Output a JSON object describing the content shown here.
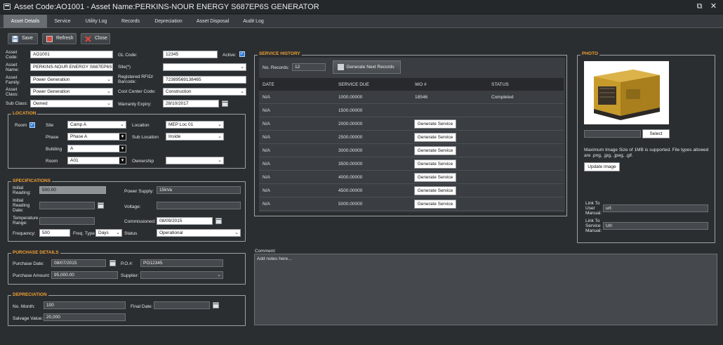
{
  "window": {
    "title": "Asset Code:AO1001 - Asset Name:PERKINS-NOUR ENERGY S687EP6S GENERATOR"
  },
  "tabs": [
    {
      "label": "Asset Details",
      "active": true
    },
    {
      "label": "Service"
    },
    {
      "label": "Utility Log"
    },
    {
      "label": "Records"
    },
    {
      "label": "Depreciation"
    },
    {
      "label": "Asset Disposal"
    },
    {
      "label": "Audit Log"
    }
  ],
  "toolbar": {
    "save": "Save",
    "refresh": "Refresh",
    "close": "Close"
  },
  "asset": {
    "code_label": "Asset Code:",
    "code": "AO1001",
    "name_label": "Asset Name:",
    "name": "PERKINS-NOUR ENERGY S687EP6S G",
    "family_label": "Asset Family:",
    "family": "Power Generation",
    "class_label": "Asset Class:",
    "class": "Power Generation",
    "subclass_label": "Sub Class:",
    "subclass": "Owned",
    "gl_label": "GL Code:",
    "gl": "12345",
    "active_label": "Active:",
    "site_label": "Site(*)",
    "site": "",
    "rfid_label": "Registered RFID/ Barcode:",
    "rfid": "72389569138465",
    "costcenter_label": "Cost Center Code:",
    "costcenter": "Construction",
    "warranty_label": "Warranty Expiry:",
    "warranty": "28/10/2017"
  },
  "location": {
    "legend": "LOCATION",
    "room_label": "Room",
    "site_label": "Site",
    "site": "Camp A",
    "phase_label": "Phase",
    "phase": "Phase A",
    "building_label": "Building",
    "building": "A",
    "room2_label": "Room",
    "room": "A01",
    "location_label": "Location",
    "location": "MEP Loc 01",
    "sublocation_label": "Sub Location",
    "sublocation": "Inside",
    "ownership_label": "Ownership",
    "ownership": ""
  },
  "specs": {
    "legend": "SPECIFICATIONS",
    "initial_reading_label": "Initial Reading:",
    "initial_reading": "500.00",
    "initial_reading_date_label": "Initial Reading Date:",
    "temp_label": "Temperature Range:",
    "frequency_label": "Frequency:",
    "frequency": "500",
    "freq_type_label": "Freq. Type",
    "freq_type": "Days",
    "power_label": "Power Supply:",
    "power": "15kVa",
    "voltage_label": "Voltage:",
    "commissioned_label": "Commissioned:",
    "commissioned": "08/09/2015",
    "status_label": "Status",
    "status": "Operational"
  },
  "purchase": {
    "legend": "PURCHASE DETAILS",
    "date_label": "Purchase Date:",
    "date": "08/07/2015",
    "amount_label": "Purchase Amount:",
    "amount": "95,000.00",
    "po_label": "P.O.#:",
    "po": "PO12345",
    "supplier_label": "Supplier:",
    "supplier": ""
  },
  "depreciation": {
    "legend": "DEPRECIATION",
    "months_label": "No. Month:",
    "months": "100",
    "salvage_label": "Salvage Value:",
    "salvage": "20,000",
    "final_label": "Final Date:"
  },
  "service_history": {
    "legend": "SERVICE HISTORY",
    "records_label": "No. Records:",
    "records": "12",
    "generate_label": "Generate Next Records",
    "columns": [
      "DATE",
      "SERVICE DUE",
      "WO #",
      "STATUS"
    ],
    "rows": [
      {
        "date": "N/A",
        "due": "1000.00000",
        "wo": "18546",
        "status": "Completed"
      },
      {
        "date": "N/A",
        "due": "1500.00000",
        "wo": "",
        "status": ""
      },
      {
        "date": "N/A",
        "due": "2000.00000",
        "wo": "Generate Service",
        "status": ""
      },
      {
        "date": "N/A",
        "due": "2500.00000",
        "wo": "Generate Service",
        "status": ""
      },
      {
        "date": "N/A",
        "due": "3000.00000",
        "wo": "Generate Service",
        "status": ""
      },
      {
        "date": "N/A",
        "due": "3500.00000",
        "wo": "Generate Service",
        "status": ""
      },
      {
        "date": "N/A",
        "due": "4000.00000",
        "wo": "Generate Service",
        "status": ""
      },
      {
        "date": "N/A",
        "due": "4500.00000",
        "wo": "Generate Service",
        "status": ""
      },
      {
        "date": "N/A",
        "due": "5000.00000",
        "wo": "Generate Service",
        "status": ""
      }
    ]
  },
  "photo": {
    "legend": "PHOTO",
    "select_label": "Select",
    "note": "Maximum Image Size of 1MB is supported. File types allowed are .png, .jpg, .jpeg, .gif.",
    "update_label": "Update image",
    "user_manual_label": "Link To User Manual:",
    "user_manual": "url:",
    "service_manual_label": "Link To Service Manual:",
    "service_manual": "Url:"
  },
  "comment": {
    "label": "Comment:",
    "placeholder": "Add notes here..."
  }
}
